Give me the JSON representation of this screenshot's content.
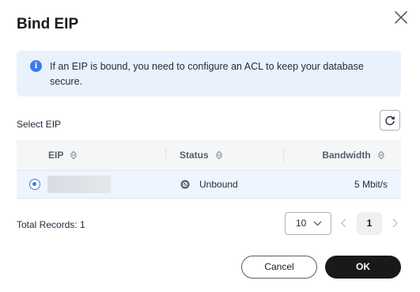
{
  "dialog": {
    "title": "Bind EIP"
  },
  "notice": {
    "icon": "info-icon",
    "text": "If an EIP is bound, you need to configure an ACL to keep your database secure."
  },
  "select_label": "Select EIP",
  "table": {
    "columns": [
      "EIP",
      "Status",
      "Bandwidth"
    ],
    "rows": [
      {
        "selected": true,
        "eip": "",
        "status": "Unbound",
        "bandwidth": "5 Mbit/s"
      }
    ]
  },
  "pagination": {
    "total_label": "Total Records: 1",
    "page_size": "10",
    "current_page": "1"
  },
  "buttons": {
    "cancel": "Cancel",
    "ok": "OK"
  },
  "colors": {
    "accent": "#3b78f3",
    "notice_bg": "#e9f2fc",
    "primary_button": "#191919"
  }
}
